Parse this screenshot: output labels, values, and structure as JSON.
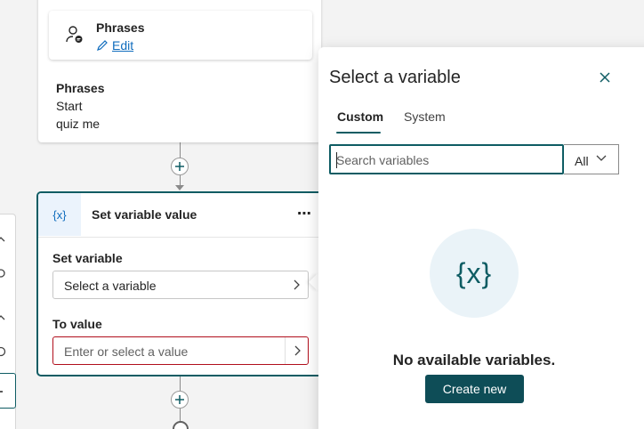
{
  "trigger_card": {
    "title": "Phrases",
    "edit_label": "Edit",
    "phrases_heading": "Phrases",
    "phrases": [
      "Start",
      "quiz me"
    ]
  },
  "set_variable_card": {
    "icon_glyph": "{x}",
    "title": "Set variable value",
    "more_label": "⋯",
    "set_variable_label": "Set variable",
    "set_variable_value": "Select a variable",
    "to_value_label": "To value",
    "to_value_placeholder": "Enter or select a value"
  },
  "variable_panel": {
    "title": "Select a variable",
    "tabs": [
      {
        "label": "Custom",
        "active": true
      },
      {
        "label": "System",
        "active": false
      }
    ],
    "search_placeholder": "Search variables",
    "filter_value": "All",
    "empty_glyph": "{x}",
    "empty_message": "No available variables.",
    "create_button": "Create new"
  },
  "colors": {
    "accent": "#0e5c63",
    "link": "#0f6cbd",
    "error": "#b10e1c",
    "button": "#0e4d57"
  }
}
